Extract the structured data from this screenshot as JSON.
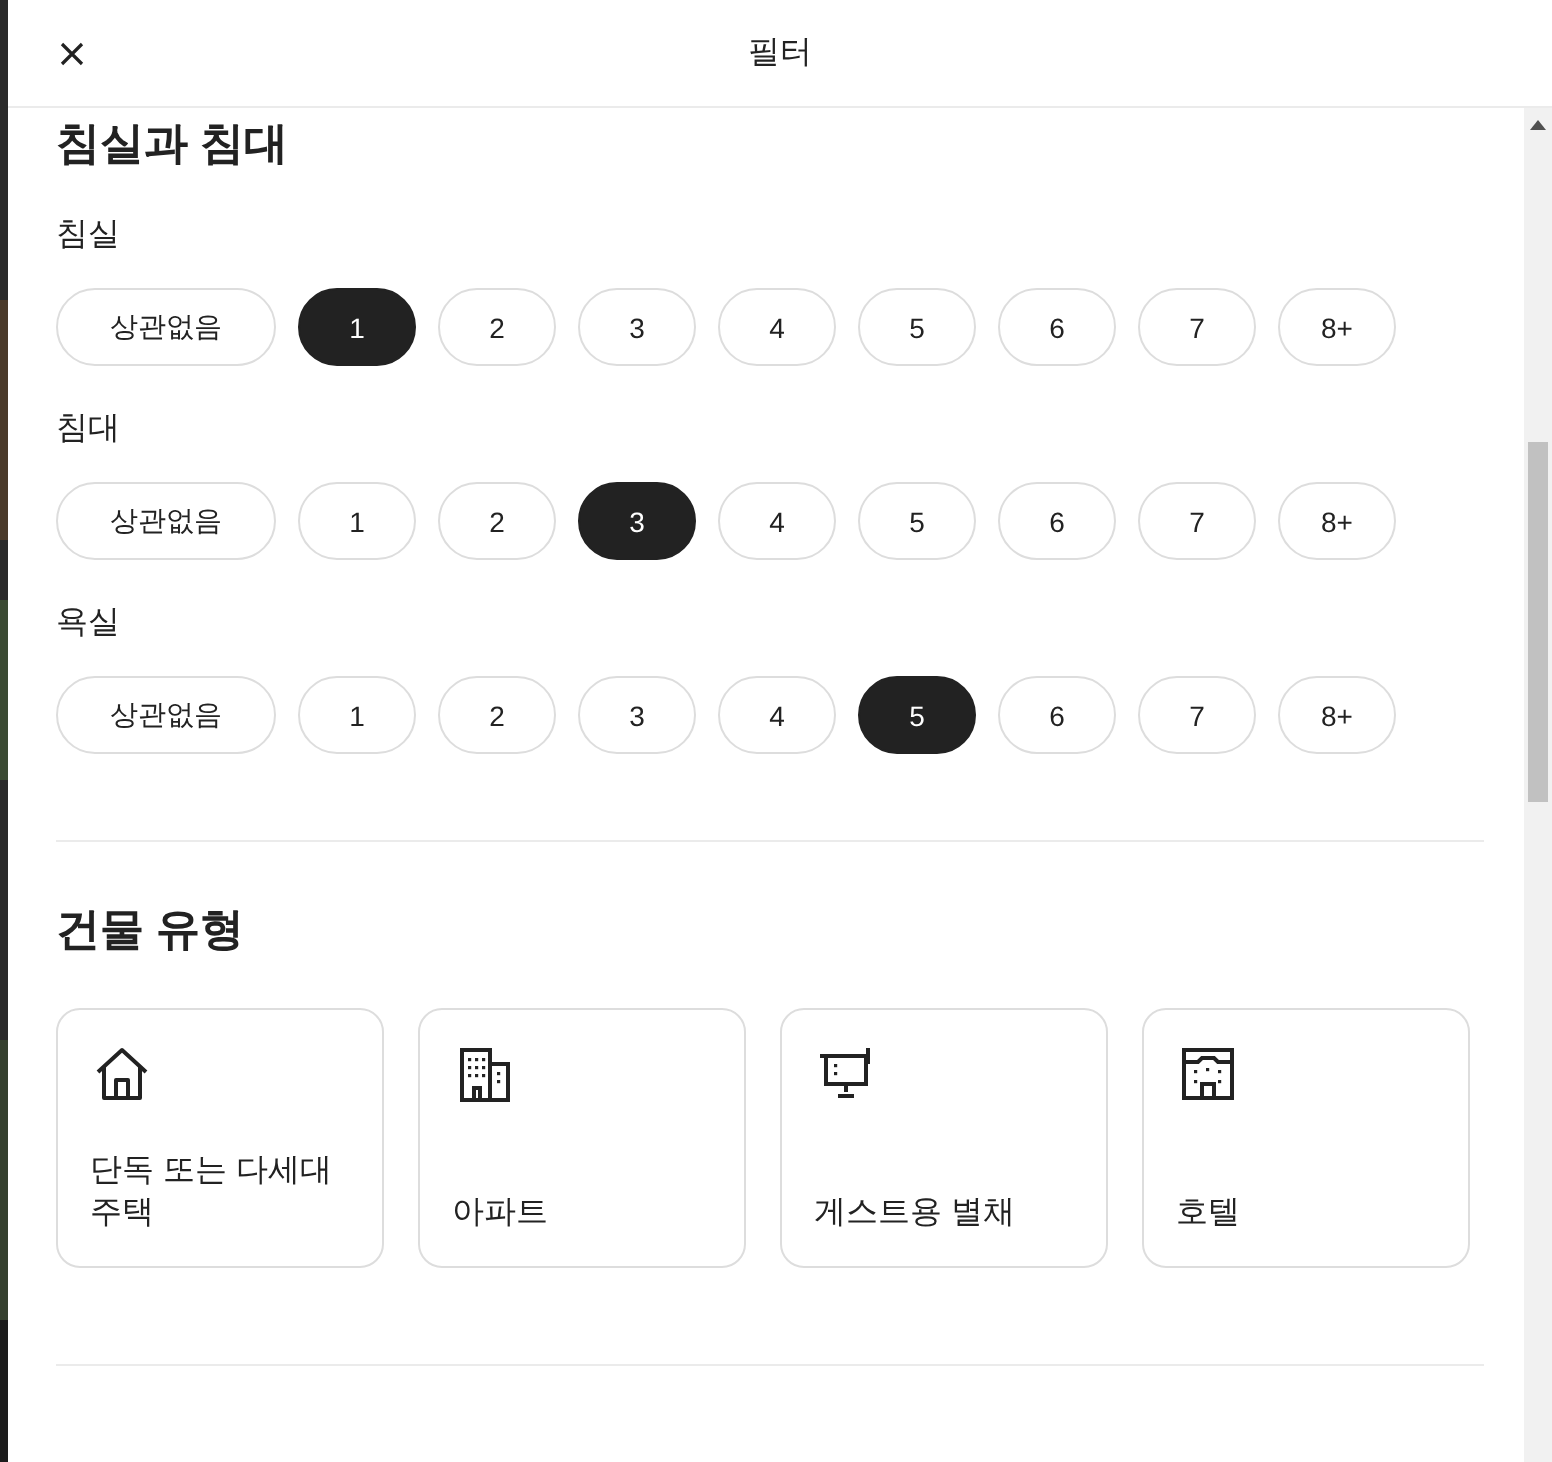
{
  "header": {
    "title": "필터"
  },
  "rooms": {
    "title": "침실과 침대",
    "groups": [
      {
        "label": "침실",
        "options": [
          {
            "label": "상관없음",
            "selected": false
          },
          {
            "label": "1",
            "selected": true
          },
          {
            "label": "2",
            "selected": false
          },
          {
            "label": "3",
            "selected": false
          },
          {
            "label": "4",
            "selected": false
          },
          {
            "label": "5",
            "selected": false
          },
          {
            "label": "6",
            "selected": false
          },
          {
            "label": "7",
            "selected": false
          },
          {
            "label": "8+",
            "selected": false
          }
        ]
      },
      {
        "label": "침대",
        "options": [
          {
            "label": "상관없음",
            "selected": false
          },
          {
            "label": "1",
            "selected": false
          },
          {
            "label": "2",
            "selected": false
          },
          {
            "label": "3",
            "selected": true
          },
          {
            "label": "4",
            "selected": false
          },
          {
            "label": "5",
            "selected": false
          },
          {
            "label": "6",
            "selected": false
          },
          {
            "label": "7",
            "selected": false
          },
          {
            "label": "8+",
            "selected": false
          }
        ]
      },
      {
        "label": "욕실",
        "options": [
          {
            "label": "상관없음",
            "selected": false
          },
          {
            "label": "1",
            "selected": false
          },
          {
            "label": "2",
            "selected": false
          },
          {
            "label": "3",
            "selected": false
          },
          {
            "label": "4",
            "selected": false
          },
          {
            "label": "5",
            "selected": true
          },
          {
            "label": "6",
            "selected": false
          },
          {
            "label": "7",
            "selected": false
          },
          {
            "label": "8+",
            "selected": false
          }
        ]
      }
    ]
  },
  "building_type": {
    "title": "건물 유형",
    "cards": [
      {
        "kind": "house",
        "label": "단독 또는 다세대 주택"
      },
      {
        "kind": "apartment",
        "label": "아파트"
      },
      {
        "kind": "guesthouse",
        "label": "게스트용 별채"
      },
      {
        "kind": "hotel",
        "label": "호텔"
      }
    ]
  }
}
